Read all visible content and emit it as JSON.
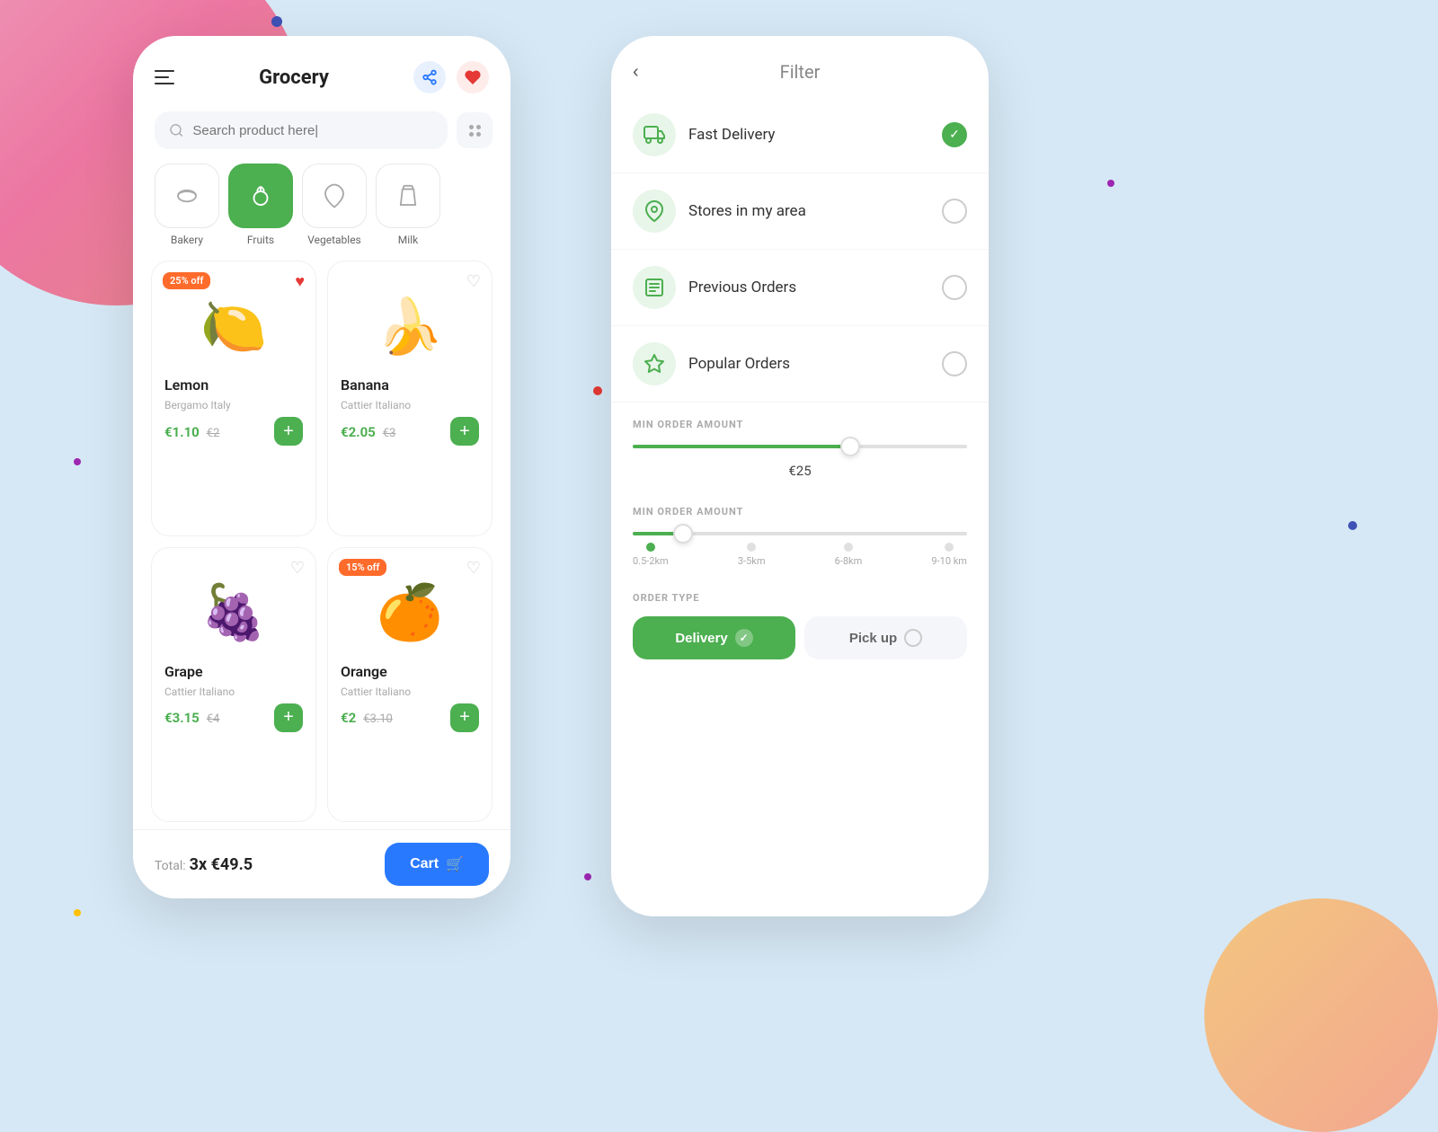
{
  "background": {
    "color": "#d6e8f5"
  },
  "left_phone": {
    "title": "Grocery",
    "search": {
      "placeholder": "Search product here|"
    },
    "categories": [
      {
        "label": "Bakery",
        "icon": "🥖",
        "active": false
      },
      {
        "label": "Fruits",
        "icon": "🍇",
        "active": true
      },
      {
        "label": "Vegetables",
        "icon": "🥦",
        "active": false
      },
      {
        "label": "Milk",
        "icon": "🥛",
        "active": false
      }
    ],
    "products": [
      {
        "name": "Lemon",
        "origin": "Bergamo Italy",
        "price": "€1.10",
        "old_price": "€2",
        "badge": "25% off",
        "emoji": "🍋",
        "favorited": true
      },
      {
        "name": "Banana",
        "origin": "Cattier Italiano",
        "price": "€2.05",
        "old_price": "€3",
        "badge": null,
        "emoji": "🍌",
        "favorited": false
      },
      {
        "name": "Grape",
        "origin": "Cattier Italiano",
        "price": "€3.15",
        "old_price": "€4",
        "badge": null,
        "emoji": "🍇",
        "favorited": false
      },
      {
        "name": "Orange",
        "origin": "Cattier Italiano",
        "price": "€2",
        "old_price": "€3.10",
        "badge": "15% off",
        "emoji": "🍊",
        "favorited": false
      }
    ],
    "cart": {
      "total_label": "Total:",
      "total_value": "3x €49.5",
      "button_label": "Cart"
    }
  },
  "right_phone": {
    "title": "Filter",
    "filters": [
      {
        "label": "Fast Delivery",
        "checked": true,
        "icon": "🚚"
      },
      {
        "label": "Stores in my area",
        "checked": false,
        "icon": "📍"
      },
      {
        "label": "Previous Orders",
        "checked": false,
        "icon": "📋"
      },
      {
        "label": "Popular Orders",
        "checked": false,
        "icon": "⭐"
      }
    ],
    "min_order": {
      "label": "MIN ORDER AMOUNT",
      "value": "€25",
      "fill_percent": 65
    },
    "distance": {
      "label": "MIN ORDER AMOUNT",
      "options": [
        "0.5-2km",
        "3-5km",
        "6-8km",
        "9-10 km"
      ],
      "active_index": 0
    },
    "order_type": {
      "label": "ORDER TYPE",
      "options": [
        {
          "label": "Delivery",
          "active": true
        },
        {
          "label": "Pick up",
          "active": false
        }
      ]
    }
  }
}
